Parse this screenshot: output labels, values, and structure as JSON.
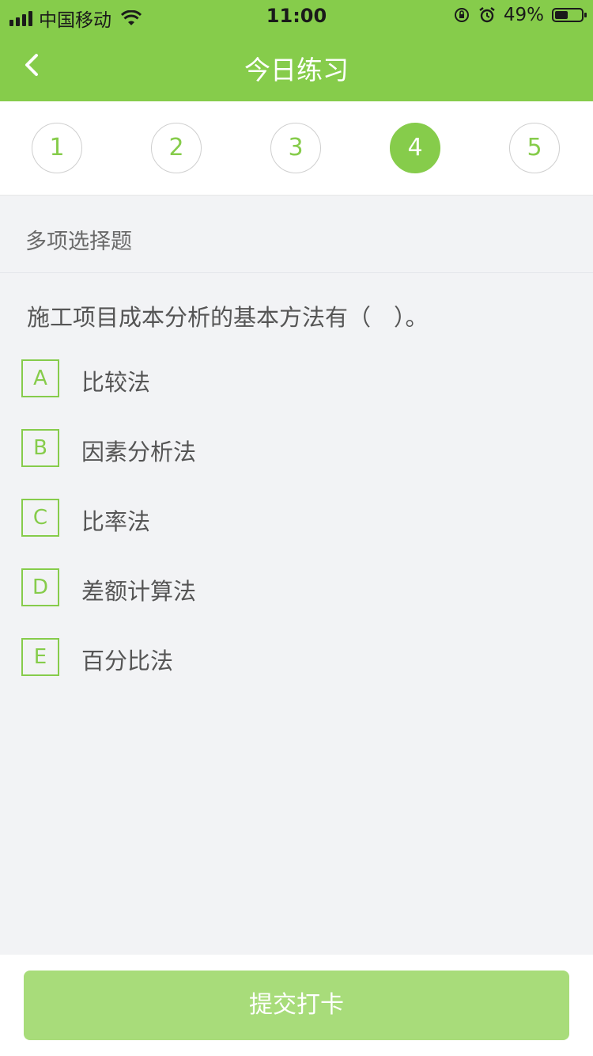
{
  "status_bar": {
    "carrier": "中国移动",
    "time": "11:00",
    "battery": "49%"
  },
  "nav": {
    "title": "今日练习"
  },
  "steps": [
    "1",
    "2",
    "3",
    "4",
    "5"
  ],
  "active_step": "4",
  "question": {
    "type": "多项选择题",
    "text": "施工项目成本分析的基本方法有（　）。",
    "options": [
      {
        "key": "A",
        "text": "比较法"
      },
      {
        "key": "B",
        "text": "因素分析法"
      },
      {
        "key": "C",
        "text": "比率法"
      },
      {
        "key": "D",
        "text": "差额计算法"
      },
      {
        "key": "E",
        "text": "百分比法"
      }
    ]
  },
  "footer": {
    "submit_label": "提交打卡"
  },
  "colors": {
    "accent": "#86cc4b",
    "submit_disabled": "#a8dc7a"
  }
}
